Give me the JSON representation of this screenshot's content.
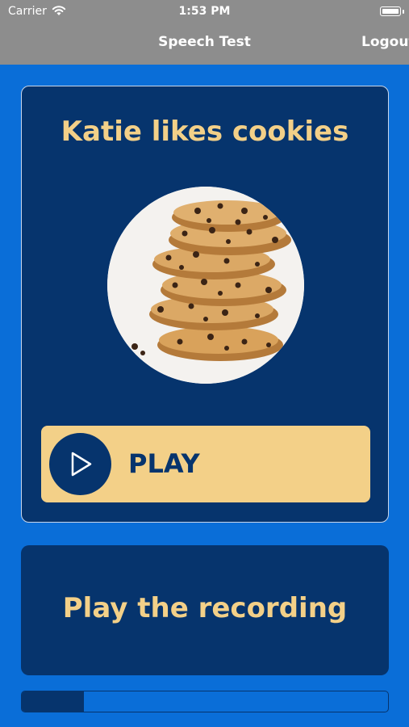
{
  "status_bar": {
    "carrier": "Carrier",
    "time": "1:53 PM"
  },
  "nav": {
    "title": "Speech Test",
    "logout_label": "Logout"
  },
  "prompt_card": {
    "title": "Katie likes cookies",
    "image": "chocolate-chip-cookie-stack",
    "play_label": "PLAY"
  },
  "recording": {
    "label": "Play the recording"
  },
  "progress": {
    "fraction": 0.17
  },
  "colors": {
    "background": "#0a6ed8",
    "card": "#06346d",
    "accent": "#f3d088",
    "nav_bar": "#8d8d8d"
  }
}
